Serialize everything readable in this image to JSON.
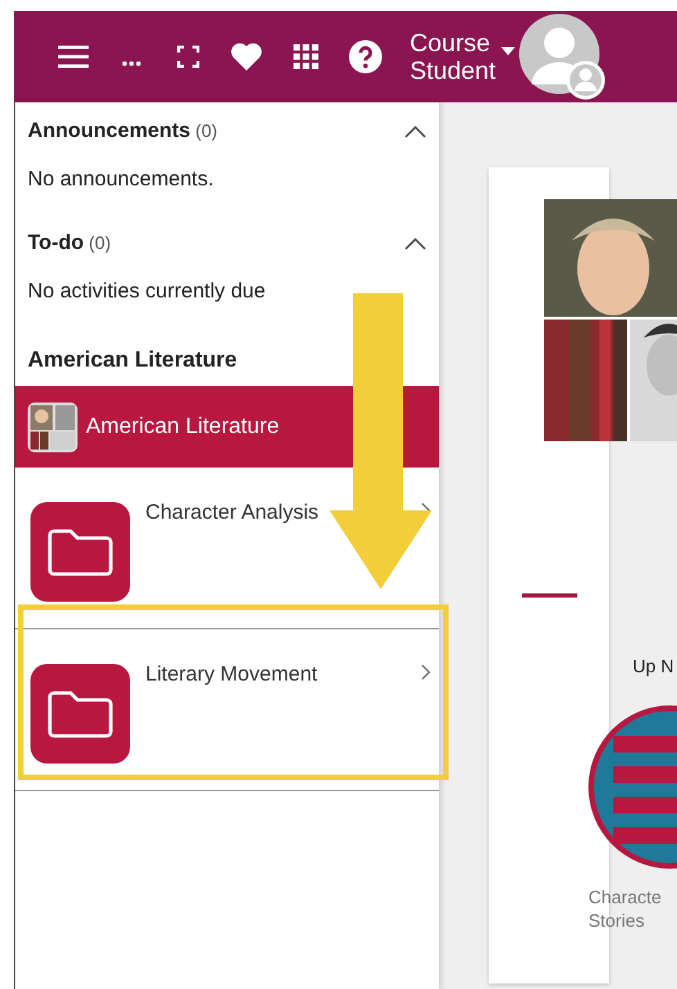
{
  "top_bar": {
    "user_name": [
      "Course",
      "Student"
    ]
  },
  "sections": [
    {
      "title": "Announcements",
      "count": "(0)",
      "expanded": true,
      "message": "No announcements."
    },
    {
      "title": "To-do",
      "count": "(0)",
      "expanded": true,
      "message": "No activities currently due"
    }
  ],
  "course": {
    "heading": "American Literature",
    "items": [
      {
        "kind": "course",
        "label": "American Literature",
        "selected": true
      },
      {
        "kind": "folder",
        "label": "Character Analysis",
        "selected": false
      },
      {
        "kind": "folder",
        "label": "Literary Movement",
        "selected": false
      }
    ]
  },
  "main": {
    "up_next": "Up N",
    "activity_lines": [
      "Characte",
      "Stories"
    ]
  }
}
